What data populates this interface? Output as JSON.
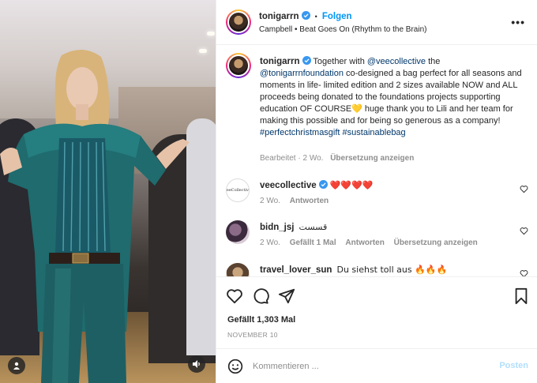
{
  "post": {
    "author": "tonigarrn",
    "follow_label": "Folgen",
    "audio": "Campbell • Beat Goes On (Rhythm to the Brain)",
    "caption": {
      "author": "tonigarrn",
      "parts": [
        {
          "text": "Together with ",
          "link": false
        },
        {
          "text": "@veecollective",
          "link": true
        },
        {
          "text": " the ",
          "link": false
        },
        {
          "text": "@tonigarrnfoundation",
          "link": true
        },
        {
          "text": " co-designed a bag perfect for all seasons and moments in life- limited edition and 2 sizes available NOW and ALL proceeds being donated to the foundations projects supporting education OF COURSE💛 huge thank you to Lili and her team for making this possible and for being so generous as a company! ",
          "link": false
        },
        {
          "text": "#perfectchristmasgift",
          "link": true
        },
        {
          "text": " ",
          "link": false
        },
        {
          "text": "#sustainablebag",
          "link": true
        }
      ],
      "edited": "Bearbeitet",
      "time": "2 Wo.",
      "translate": "Übersetzung anzeigen"
    },
    "comments": [
      {
        "user": "veecollective",
        "verified": true,
        "text": "❤️❤️❤️❤️",
        "time": "2 Wo.",
        "likes": "",
        "reply": "Antworten",
        "translate": ""
      },
      {
        "user": "bidn_jsj",
        "verified": false,
        "text": "قسست",
        "time": "2 Wo.",
        "likes": "Gefällt 1 Mal",
        "reply": "Antworten",
        "translate": "Übersetzung anzeigen"
      },
      {
        "user": "travel_lover_sun",
        "verified": false,
        "text": "Du siehst toll aus 🔥🔥🔥",
        "time": "",
        "likes": "",
        "reply": "",
        "translate": ""
      }
    ],
    "likes_label": "Gefällt 1,303 Mal",
    "date": "NOVEMBER 10",
    "composer": {
      "placeholder": "Kommentieren ...",
      "post_label": "Posten"
    },
    "avatar_vee_text": "veeCollective"
  },
  "icons": {
    "verified": "verified-badge-icon",
    "more": "more-options-icon",
    "like": "heart-icon",
    "comment": "comment-icon",
    "share": "share-icon",
    "save": "bookmark-icon",
    "emoji": "emoji-icon",
    "user_tag": "user-tag-icon",
    "sound": "sound-icon"
  },
  "colors": {
    "link": "#00376b",
    "accent": "#0095f6",
    "verified": "#3897f0",
    "muted": "#8e8e8e"
  }
}
